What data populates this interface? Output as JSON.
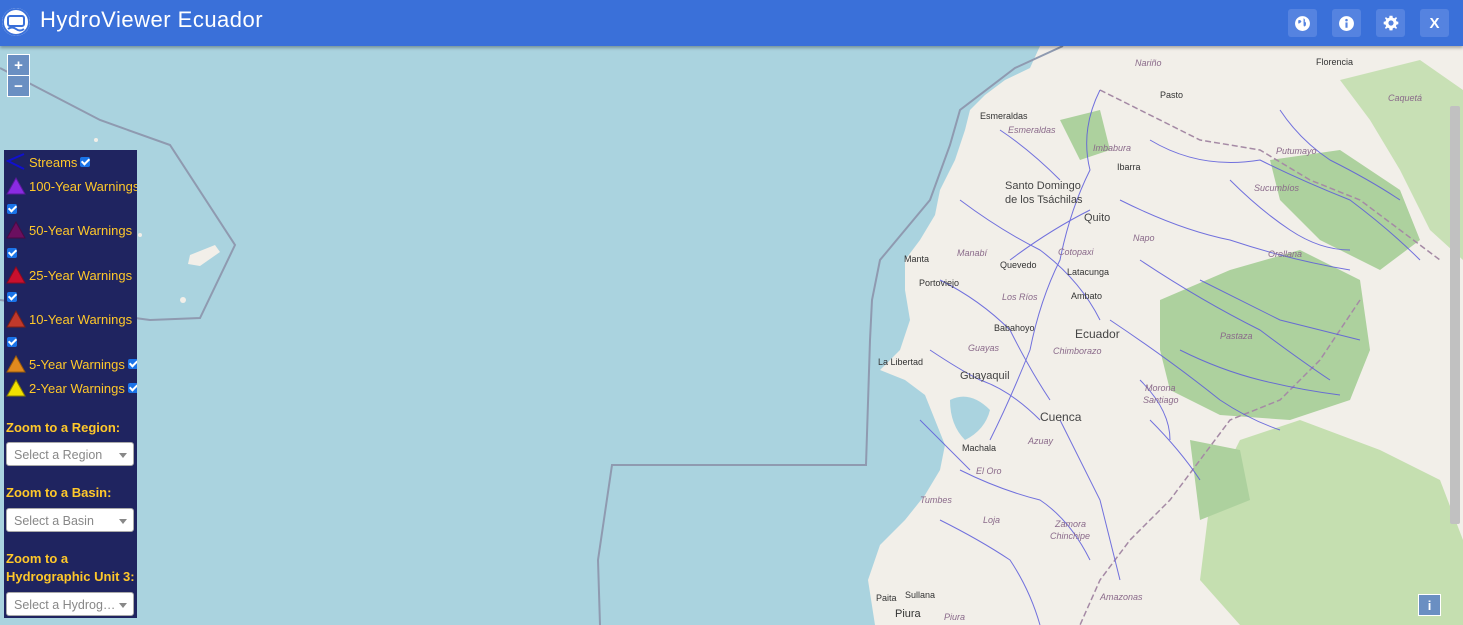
{
  "header": {
    "title": "HydroViewer Ecuador",
    "buttons": [
      "globe-icon",
      "info-icon",
      "gear-icon"
    ],
    "close_label": "X"
  },
  "map": {
    "zoom_in": "+",
    "zoom_out": "−",
    "attribution": "i",
    "places": {
      "narino": "Nariño",
      "florencia": "Florencia",
      "pasto": "Pasto",
      "caqueta": "Caquetá",
      "esmeraldas1": "Esmeraldas",
      "esmeraldas2": "Esmeraldas",
      "imbabura": "Imbabura",
      "ibarra": "Ibarra",
      "putumayo": "Putumayo",
      "sucumbios": "Sucumbíos",
      "santo_domingo": "Santo Domingo",
      "tsachilas": "de los Tsáchilas",
      "quito": "Quito",
      "napo": "Napo",
      "orellana": "Orellana",
      "cotopaxi": "Cotopaxi",
      "manta": "Manta",
      "manabi": "Manabí",
      "quevedo": "Quevedo",
      "latacunga": "Latacunga",
      "portoviejo": "Portoviejo",
      "los_rios": "Los Ríos",
      "ambato": "Ambato",
      "pastaza": "Pastaza",
      "babahoyo": "Babahoyo",
      "ecuador": "Ecuador",
      "guayas": "Guayas",
      "chimborazo": "Chimborazo",
      "la_libertad": "La Libertad",
      "guayaquil": "Guayaquil",
      "morona": "Morona",
      "santiago": "Santiago",
      "cuenca": "Cuenca",
      "azuay": "Azuay",
      "machala": "Machala",
      "el_oro": "El Oro",
      "tumbes": "Tumbes",
      "loja": "Loja",
      "zamora": "Zamora",
      "chinchipe": "Chinchipe",
      "paita": "Paita",
      "sullana": "Sullana",
      "amazonas": "Amazonas",
      "piura1": "Piura",
      "piura2": "Piura"
    }
  },
  "legend": {
    "streams": "Streams",
    "w100": "100-Year Warnings",
    "w50": "50-Year Warnings",
    "w25": "25-Year Warnings",
    "w10": "10-Year Warnings",
    "w5": "5-Year Warnings",
    "w2": "2-Year Warnings",
    "colors": {
      "streams": "#1010d0",
      "w100": "#8a2be2",
      "w50": "#6b0f5f",
      "w25": "#c8102e",
      "w10": "#c0392b",
      "w5": "#e08a1e",
      "w2": "#f1e000"
    }
  },
  "controls": {
    "region_label": "Zoom to a Region:",
    "region_placeholder": "Select a Region",
    "basin_label": "Zoom to a Basin:",
    "basin_placeholder": "Select a Basin",
    "unit_label_1": "Zoom to a",
    "unit_label_2": "Hydrographic Unit 3:",
    "unit_placeholder": "Select a Hydrog…"
  }
}
